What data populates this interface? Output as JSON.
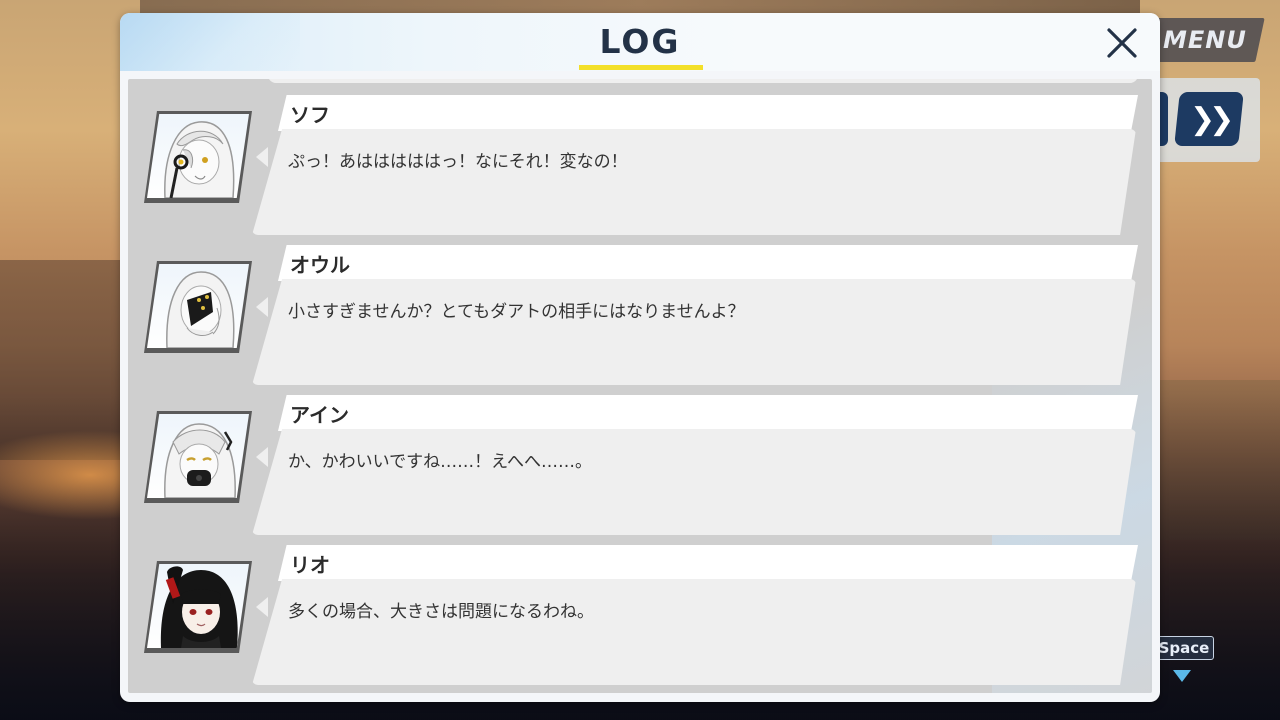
{
  "window": {
    "title": "LOG"
  },
  "hud": {
    "menu_label": "MENU",
    "space_label": "Space"
  },
  "entries": [
    {
      "speaker": "ソフ",
      "text": "ぷっ！あはははははっ！なにそれ！変なの！",
      "avatar": "soph-portrait"
    },
    {
      "speaker": "オウル",
      "text": "小さすぎませんか？とてもダアトの相手にはなりませんよ？",
      "avatar": "owl-portrait"
    },
    {
      "speaker": "アイン",
      "text": "か、かわいいですね……！えへへ……。",
      "avatar": "ein-portrait"
    },
    {
      "speaker": "リオ",
      "text": "多くの場合、大きさは問題になるわね。",
      "avatar": "rio-portrait"
    }
  ],
  "colors": {
    "title_underline": "#f3e02a",
    "skip_button": "#1d3a62",
    "space_arrow": "#5ab8e8"
  }
}
